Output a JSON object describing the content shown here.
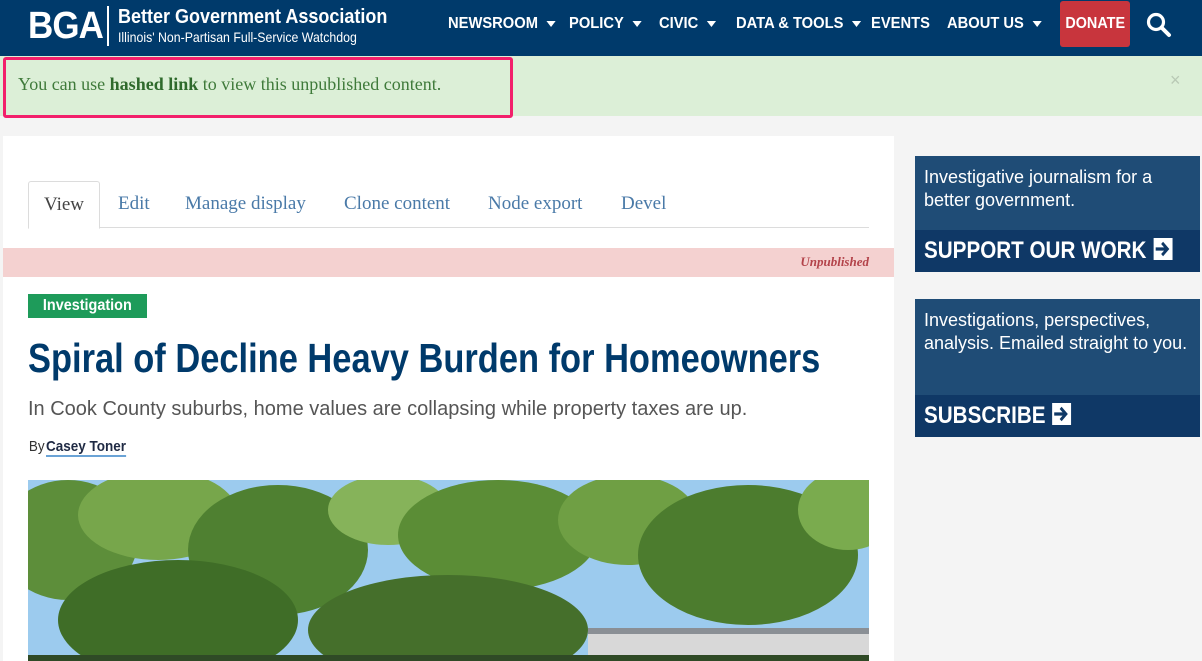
{
  "header": {
    "logo_mark": "BGA",
    "org_name": "Better Government Association",
    "tagline": "Illinois' Non-Partisan Full-Service Watchdog",
    "nav": [
      {
        "label": "NEWSROOM",
        "dropdown": true
      },
      {
        "label": "POLICY",
        "dropdown": true
      },
      {
        "label": "CIVIC",
        "dropdown": true
      },
      {
        "label": "DATA & TOOLS",
        "dropdown": true
      },
      {
        "label": "EVENTS",
        "dropdown": false
      },
      {
        "label": "ABOUT US",
        "dropdown": true
      }
    ],
    "donate_label": "DONATE",
    "search_icon": "search-icon"
  },
  "status": {
    "prefix": "You can use ",
    "link_text": "hashed link",
    "suffix": " to view this unpublished content.",
    "close_glyph": "×"
  },
  "tabs": [
    "View",
    "Edit",
    "Manage display",
    "Clone content",
    "Node export",
    "Devel"
  ],
  "article": {
    "unpublished_label": "Unpublished",
    "category": "Investigation",
    "title": "Spiral of Decline Heavy Burden for Homeowners",
    "subtitle": "In Cook County suburbs, home values are collapsing while property taxes are up.",
    "byline_prefix": "By ",
    "author": "Casey Toner"
  },
  "sidebar": {
    "support": {
      "text": "Investigative journalism for a better government.",
      "cta": "SUPPORT OUR WORK"
    },
    "subscribe": {
      "text": "Investigations, perspectives, analysis. Emailed straight to you.",
      "cta": "SUBSCRIBE"
    }
  },
  "colors": {
    "header_bg": "#003a6b",
    "donate_bg": "#c8353d",
    "status_bg": "#dcefd7",
    "highlight_border": "#f2206b",
    "badge_bg": "#1e9b5a",
    "sidebar_bg": "#1f4c76"
  }
}
